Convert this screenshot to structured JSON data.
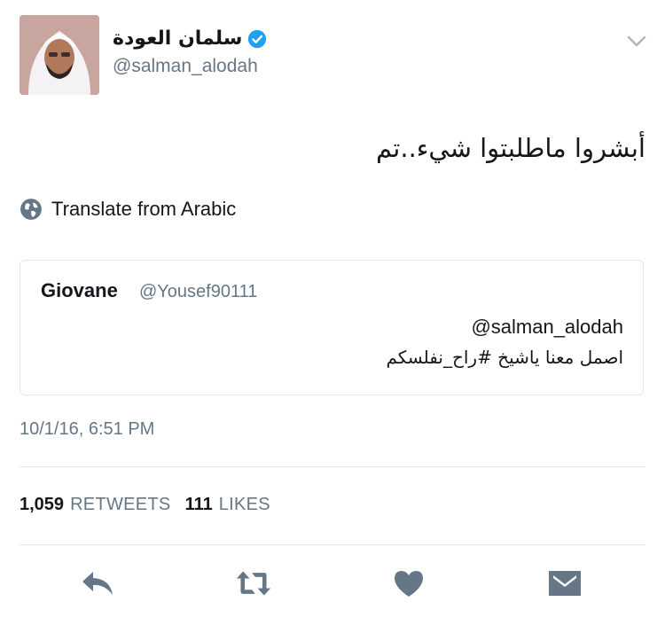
{
  "user": {
    "display_name": "سلمان العودة",
    "handle": "@salman_alodah",
    "verified": true
  },
  "tweet": {
    "text": "أبشروا ماطلبتوا شيء..تم",
    "translate_label": "Translate from Arabic",
    "timestamp": "10/1/16, 6:51 PM"
  },
  "quoted_tweet": {
    "name": "Giovane",
    "handle": "@Yousef90111",
    "line1": "@salman_alodah",
    "line2": "اصمل معنا ياشيخ #راح_نفلسكم"
  },
  "stats": {
    "retweets_count": "1,059",
    "retweets_label": "RETWEETS",
    "likes_count": "111",
    "likes_label": "LIKES"
  },
  "actions": [
    "reply-icon",
    "retweet-icon",
    "like-icon",
    "message-icon"
  ],
  "colors": {
    "text": "#14171a",
    "secondary": "#657786",
    "divider": "#e1e8ed",
    "verified": "#1da1f2"
  }
}
